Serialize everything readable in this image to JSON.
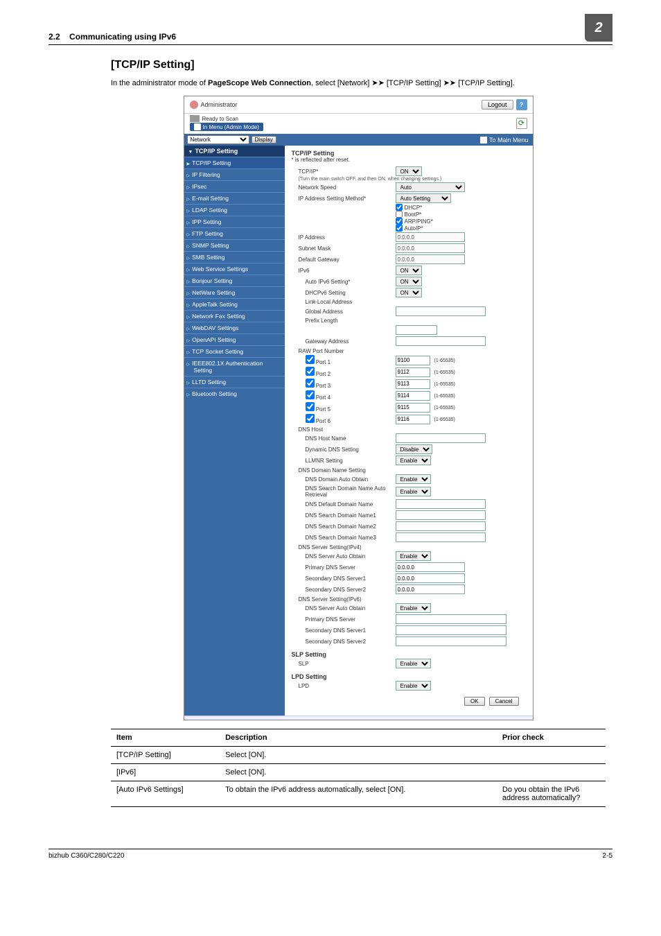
{
  "header": {
    "section": "2.2",
    "title": "Communicating using IPv6",
    "chapter": "2"
  },
  "main": {
    "heading": "[TCP/IP Setting]",
    "intro_a": "In the administrator mode of ",
    "intro_b": "PageScope Web Connection",
    "intro_c": ", select [Network] ➤➤ [TCP/IP Setting] ➤➤ [TCP/IP Setting]."
  },
  "shot": {
    "admin": "Administrator",
    "logout": "Logout",
    "ready": "Ready to Scan",
    "in_menu": "In Menu (Admin Mode)",
    "network_sel": "Network",
    "display": "Display",
    "to_main_menu": "To Main Menu",
    "side_head": "TCP/IP Setting",
    "side": [
      "TCP/IP Setting",
      "IP Filtering",
      "IPsec",
      "E-mail Setting",
      "LDAP Setting",
      "IPP Setting",
      "FTP Setting",
      "SNMP Setting",
      "SMB Setting",
      "Web Service Settings",
      "Bonjour Setting",
      "NetWare Setting",
      "AppleTalk Setting",
      "Network Fax Setting",
      "WebDAV Settings",
      "OpenAPI Setting",
      "TCP Socket Setting",
      "IEEE802.1X Authentication Setting",
      "LLTD Setting",
      "Bluetooth Setting"
    ],
    "panel": {
      "head": "TCP/IP Setting",
      "note": "* is reflected after reset.",
      "tcpip_lbl": "TCP/IP*",
      "tcpip_val": "ON",
      "hint": "(Turn the main switch OFF, and then ON, when changing settings.)",
      "netspeed_lbl": "Network Speed",
      "netspeed_val": "Auto",
      "ipmethod_lbl": "IP Address Setting Method*",
      "ipmethod_val": "Auto Setting",
      "chk_dhcp": "DHCP*",
      "chk_boot": "BootP*",
      "chk_arp": "ARP/PING*",
      "chk_auto": "AutoIP*",
      "ipaddr_lbl": "IP Address",
      "ipaddr_val": "0.0.0.0",
      "subnet_lbl": "Subnet Mask",
      "subnet_val": "0.0.0.0",
      "gw_lbl": "Default Gateway",
      "gw_val": "0.0.0.0",
      "ipv6_lbl": "IPv6",
      "ipv6_val": "ON",
      "auto6_lbl": "Auto IPv6 Setting*",
      "auto6_val": "ON",
      "dhcp6_lbl": "DHCPv6 Setting",
      "dhcp6_val": "ON",
      "ll_lbl": "Link-Local Address",
      "ga_lbl": "Global Address",
      "pl_lbl": "Prefix Length",
      "gw6_lbl": "Gateway Address",
      "raw_head": "RAW Port Number",
      "ports": [
        {
          "lbl": "Port 1",
          "val": "9100"
        },
        {
          "lbl": "Port 2",
          "val": "9112"
        },
        {
          "lbl": "Port 3",
          "val": "9113"
        },
        {
          "lbl": "Port 4",
          "val": "9114"
        },
        {
          "lbl": "Port 5",
          "val": "9115"
        },
        {
          "lbl": "Port 6",
          "val": "9116"
        }
      ],
      "port_range": "(1-65535)",
      "dnshost": "DNS Host",
      "dnshostname_lbl": "DNS Host Name",
      "dyndns_lbl": "Dynamic DNS Setting",
      "dyndns_val": "Disable",
      "llmnr_lbl": "LLMNR Setting",
      "llmnr_val": "Enable",
      "dnsdom_head": "DNS Domain Name Setting",
      "dda_lbl": "DNS Domain Auto Obtain",
      "dda_val": "Enable",
      "dsa_lbl": "DNS Search Domain Name Auto Retrieval",
      "dsa_val": "Enable",
      "ddn_lbl": "DNS Default Domain Name",
      "dsn1_lbl": "DNS Search Domain Name1",
      "dsn2_lbl": "DNS Search Domain Name2",
      "dsn3_lbl": "DNS Search Domain Name3",
      "dss4_head": "DNS Server Setting(IPv4)",
      "dsso4_lbl": "DNS Server Auto Obtain",
      "dsso4_val": "Enable",
      "pdns_lbl": "Primary DNS Server",
      "pdns_val": "0.0.0.0",
      "sdns1_lbl": "Secondary DNS Server1",
      "sdns1_val": "0.0.0.0",
      "sdns2_lbl": "Secondary DNS Server2",
      "sdns2_val": "0.0.0.0",
      "dss6_head": "DNS Server Setting(IPv6)",
      "dsso6_lbl": "DNS Server Auto Obtain",
      "dsso6_val": "Enable",
      "pdns6_lbl": "Primary DNS Server",
      "sdns61_lbl": "Secondary DNS Server1",
      "sdns62_lbl": "Secondary DNS Server2",
      "slp_head": "SLP Setting",
      "slp_lbl": "SLP",
      "slp_val": "Enable",
      "lpd_head": "LPD Setting",
      "lpd_lbl": "LPD",
      "lpd_val": "Enable",
      "ok": "OK",
      "cancel": "Cancel"
    }
  },
  "table": {
    "h1": "Item",
    "h2": "Description",
    "h3": "Prior check",
    "rows": [
      {
        "a": "[TCP/IP Setting]",
        "b": "Select [ON].",
        "c": ""
      },
      {
        "a": "[IPv6]",
        "b": "Select [ON].",
        "c": ""
      },
      {
        "a": "[Auto IPv6 Settings]",
        "b": "To obtain the IPv6 address automatically, select [ON].",
        "c": "Do you obtain the IPv6 address automatically?"
      }
    ]
  },
  "footer": {
    "left": "bizhub C360/C280/C220",
    "right": "2-5"
  }
}
